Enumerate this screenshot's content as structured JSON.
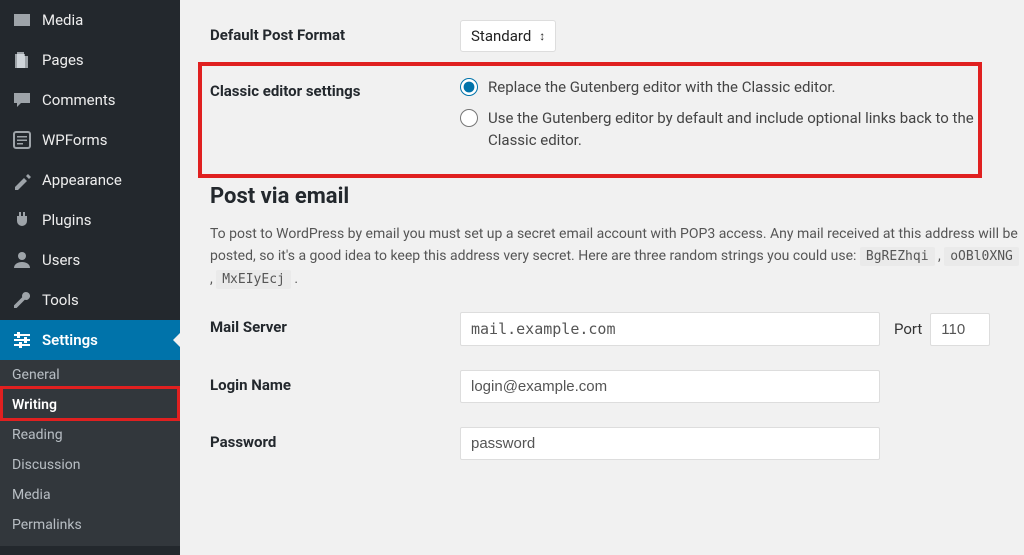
{
  "sidebar": {
    "items": [
      {
        "label": "Media",
        "icon": "media"
      },
      {
        "label": "Pages",
        "icon": "pages"
      },
      {
        "label": "Comments",
        "icon": "comments"
      },
      {
        "label": "WPForms",
        "icon": "wpforms"
      },
      {
        "label": "Appearance",
        "icon": "appearance"
      },
      {
        "label": "Plugins",
        "icon": "plugins"
      },
      {
        "label": "Users",
        "icon": "users"
      },
      {
        "label": "Tools",
        "icon": "tools"
      },
      {
        "label": "Settings",
        "icon": "settings",
        "current": true
      }
    ],
    "submenu": [
      {
        "label": "General"
      },
      {
        "label": "Writing",
        "current": true
      },
      {
        "label": "Reading"
      },
      {
        "label": "Discussion"
      },
      {
        "label": "Media"
      },
      {
        "label": "Permalinks"
      }
    ]
  },
  "settings": {
    "default_post_format": {
      "label": "Default Post Format",
      "value": "Standard"
    },
    "classic_editor": {
      "label": "Classic editor settings",
      "option1": "Replace the Gutenberg editor with the Classic editor.",
      "option2": "Use the Gutenberg editor by default and include optional links back to the Classic editor.",
      "selected": 0
    },
    "post_via_email": {
      "heading": "Post via email",
      "desc_prefix": "To post to WordPress by email you must set up a secret email account with POP3 access. Any mail received at this address will be posted, so it's a good idea to keep this address very secret. Here are three random strings you could use: ",
      "codes": [
        "BgREZhqi",
        "oOBl0XNG",
        "MxEIyEcj"
      ]
    },
    "mail_server": {
      "label": "Mail Server",
      "value": "mail.example.com",
      "port_label": "Port",
      "port_value": "110"
    },
    "login_name": {
      "label": "Login Name",
      "value": "login@example.com"
    },
    "password": {
      "label": "Password",
      "value": "password"
    }
  }
}
